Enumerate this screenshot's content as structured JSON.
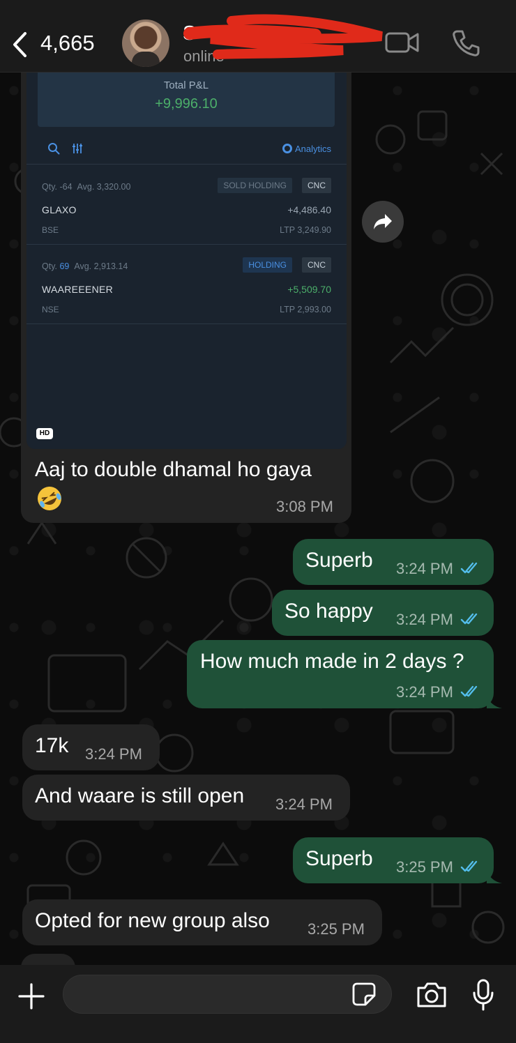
{
  "header": {
    "back_count": "4,665",
    "contact_name": "S———g",
    "status": "online"
  },
  "image_message": {
    "shared_screenshot": {
      "total_pnl_label": "Total P&L",
      "total_pnl_value": "+9,996.10",
      "analytics_label": "Analytics",
      "holdings": [
        {
          "qty_label": "Qty.",
          "qty": "-64",
          "avg_label": "Avg.",
          "avg": "3,320.00",
          "tag": "SOLD HOLDING",
          "product": "CNC",
          "name": "GLAXO",
          "pnl": "+4,486.40",
          "exchange": "BSE",
          "ltp": "LTP 3,249.90"
        },
        {
          "qty_label": "Qty.",
          "qty": "69",
          "avg_label": "Avg.",
          "avg": "2,913.14",
          "tag": "HOLDING",
          "product": "CNC",
          "name": "WAAREEENER",
          "pnl": "+5,509.70",
          "exchange": "NSE",
          "ltp": "LTP 2,993.00"
        }
      ]
    },
    "hd_badge": "HD",
    "caption": "Aaj to double dhamal ho gaya",
    "emoji": "rolling-on-floor-laughing",
    "time": "3:08 PM"
  },
  "messages": [
    {
      "dir": "out",
      "text": "Superb",
      "time": "3:24 PM",
      "read": true
    },
    {
      "dir": "out",
      "text": "So happy",
      "time": "3:24 PM",
      "read": true
    },
    {
      "dir": "out",
      "text": "How much made in 2 days ?",
      "time": "3:24 PM",
      "read": true
    },
    {
      "dir": "in",
      "text": "17k",
      "time": "3:24 PM"
    },
    {
      "dir": "in",
      "text": "And waare is still open",
      "time": "3:24 PM"
    },
    {
      "dir": "out",
      "text": "Superb",
      "time": "3:25 PM",
      "read": true
    },
    {
      "dir": "in",
      "text": "Opted for new group also",
      "time": "3:25 PM"
    }
  ],
  "composer": {
    "placeholder": ""
  },
  "colors": {
    "outgoing_bubble": "#1f5138",
    "incoming_bubble": "#232323",
    "read_tick": "#53bdeb",
    "profit_green": "#4caf6a"
  },
  "icons": [
    "chevron-left-icon",
    "video-call-icon",
    "phone-icon",
    "forward-icon",
    "plus-icon",
    "sticker-icon",
    "camera-icon",
    "mic-icon",
    "double-check-icon"
  ]
}
